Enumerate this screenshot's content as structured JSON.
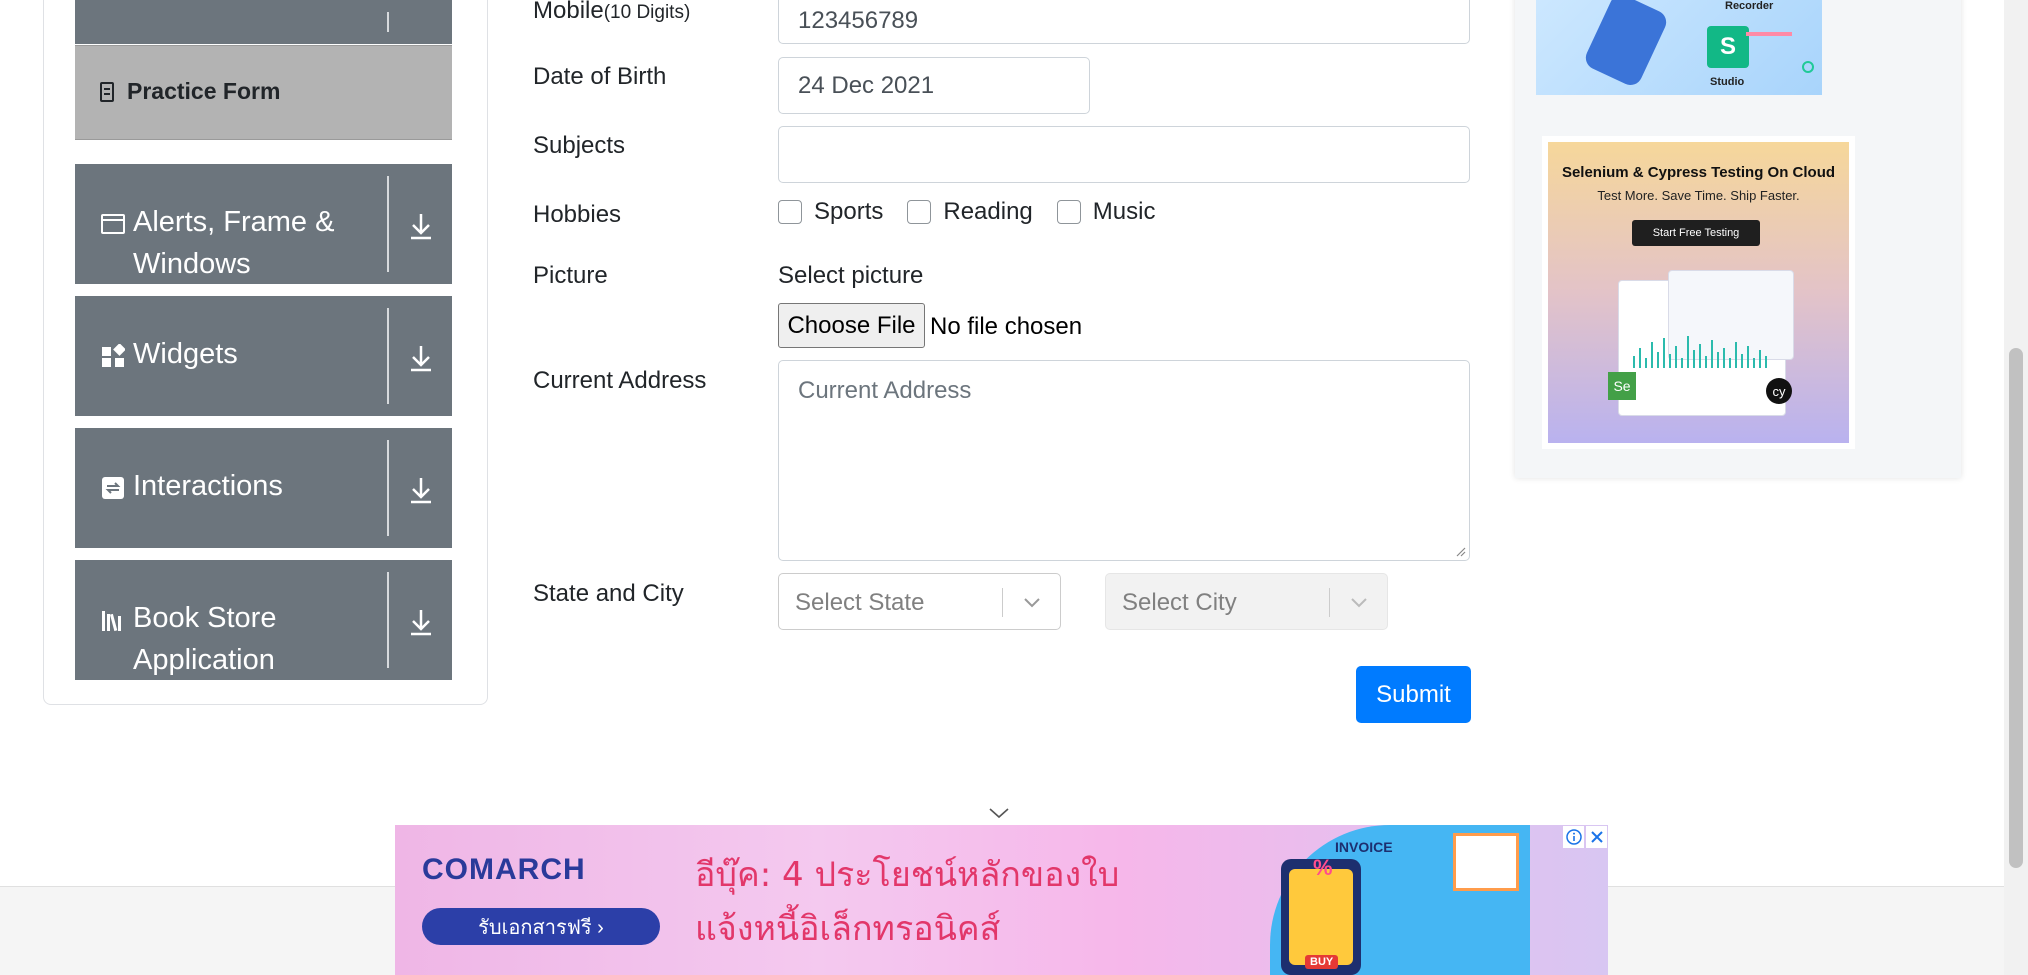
{
  "sidebar": {
    "practice_form": "Practice Form",
    "items": [
      {
        "label": "Alerts, Frame & Windows",
        "line1": "Alerts, Frame &",
        "line2": "Windows"
      },
      {
        "label": "Widgets"
      },
      {
        "label": "Interactions"
      },
      {
        "label": "Book Store Application",
        "line1": "Book Store",
        "line2": "Application"
      }
    ]
  },
  "form": {
    "mobile_label": "Mobile",
    "mobile_hint": "(10 Digits)",
    "mobile_value": "123456789",
    "dob_label": "Date of Birth",
    "dob_value": "24 Dec 2021",
    "subjects_label": "Subjects",
    "subjects_value": "",
    "hobbies_label": "Hobbies",
    "hobbies": [
      {
        "label": "Sports",
        "checked": false
      },
      {
        "label": "Reading",
        "checked": false
      },
      {
        "label": "Music",
        "checked": false
      }
    ],
    "picture_label": "Picture",
    "select_picture": "Select picture",
    "choose_file": "Choose File",
    "file_status": "No file chosen",
    "address_label": "Current Address",
    "address_placeholder": "Current Address",
    "state_city_label": "State and City",
    "state_placeholder": "Select State",
    "city_placeholder": "Select City",
    "submit": "Submit"
  },
  "ads": {
    "top": {
      "recorder": "Recorder",
      "studio": "Studio",
      "logo_letter": "S"
    },
    "cloud": {
      "headline": "Selenium & Cypress Testing On Cloud",
      "subline": "Test More. Save Time. Ship Faster.",
      "button": "Start Free Testing",
      "se_badge": "Se",
      "cy_badge": "cy"
    },
    "banner": {
      "brand": "COMARCH",
      "cta": "รับเอกสารฟรี ›",
      "line1": "อีบุ๊ค: 4 ประโยชน์หลักของใบ",
      "line2": "แจ้งหนี้อิเล็กทรอนิคส์",
      "invoice": "INVOICE",
      "percent": "%",
      "buy": "BUY"
    }
  },
  "colors": {
    "nav_bg": "#6c757d",
    "active_nav_bg": "#b3b3b3",
    "primary": "#007bff"
  }
}
